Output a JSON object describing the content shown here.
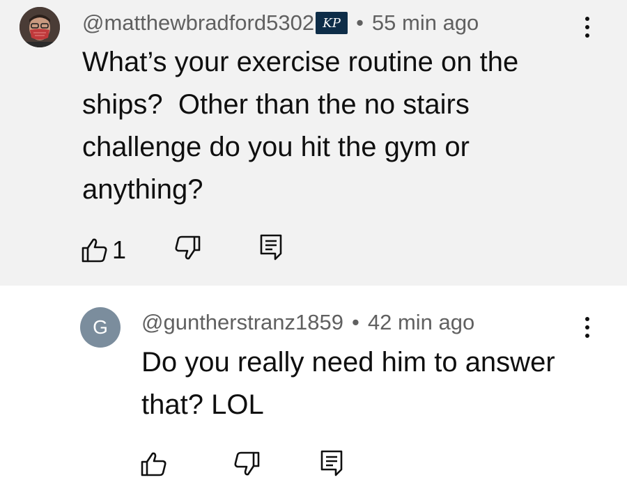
{
  "comments": [
    {
      "author": "@matthewbradford5302",
      "badge": "KP",
      "separator": "•",
      "time": "55 min ago",
      "text": "What’s your exercise routine on the ships?  Other than the no stairs challenge do you hit the gym or anything?",
      "like_count": "1",
      "icons": [
        "thumbs-up-icon",
        "thumbs-down-icon",
        "reply-icon",
        "more-vert-icon"
      ]
    },
    {
      "avatar_letter": "G",
      "author": "@guntherstranz1859",
      "separator": "•",
      "time": "42 min ago",
      "text": "Do you really need him to answer that? LOL",
      "icons": [
        "thumbs-up-icon",
        "thumbs-down-icon",
        "reply-icon",
        "more-vert-icon"
      ]
    }
  ],
  "colors": {
    "highlight_bg": "#f2f2f2",
    "meta_text": "#606060",
    "avatar_g_bg": "#7b8d9d",
    "badge_bg": "#0e2d48"
  }
}
